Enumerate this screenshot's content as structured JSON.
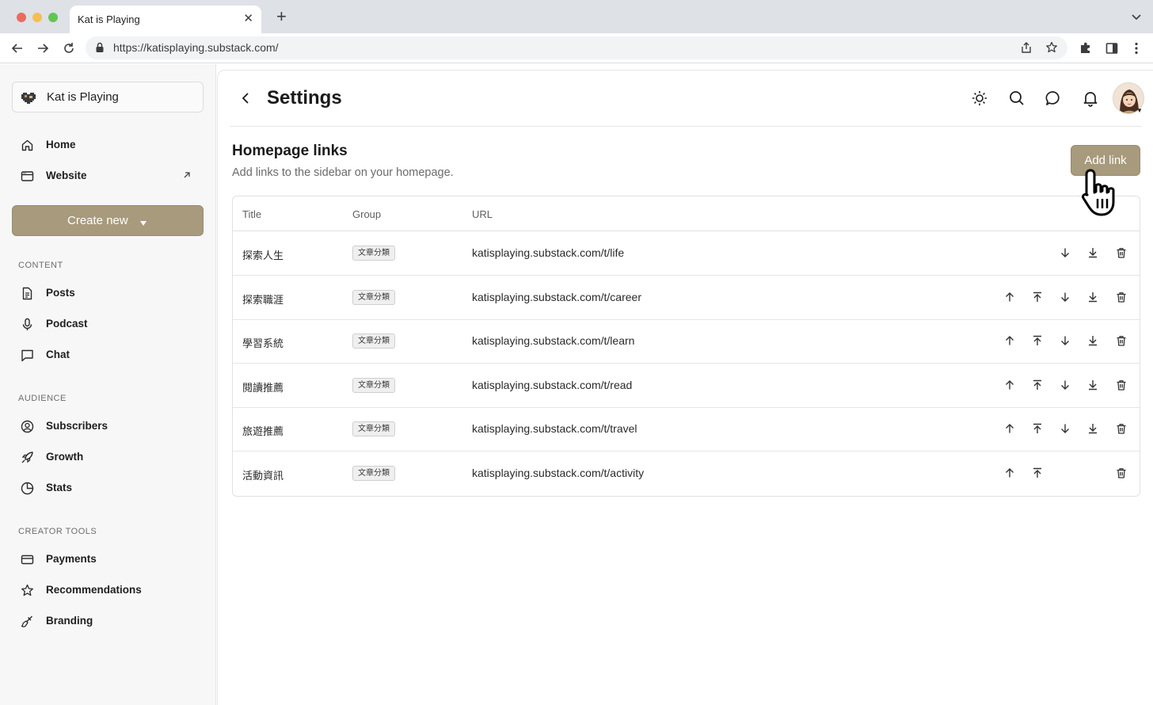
{
  "browser": {
    "tab_title": "Kat is Playing",
    "url": "https://katisplaying.substack.com/"
  },
  "sidebar": {
    "publication": "Kat is Playing",
    "nav": [
      {
        "label": "Home",
        "icon": "home-icon"
      },
      {
        "label": "Website",
        "icon": "browser-window-icon"
      }
    ],
    "create_label": "Create new",
    "sections": [
      {
        "label": "CONTENT",
        "items": [
          {
            "label": "Posts",
            "icon": "document-icon"
          },
          {
            "label": "Podcast",
            "icon": "microphone-icon"
          },
          {
            "label": "Chat",
            "icon": "chat-bubble-icon"
          }
        ]
      },
      {
        "label": "AUDIENCE",
        "items": [
          {
            "label": "Subscribers",
            "icon": "user-circle-icon"
          },
          {
            "label": "Growth",
            "icon": "rocket-icon"
          },
          {
            "label": "Stats",
            "icon": "pie-chart-icon"
          }
        ]
      },
      {
        "label": "CREATOR TOOLS",
        "items": [
          {
            "label": "Payments",
            "icon": "credit-card-icon"
          },
          {
            "label": "Recommendations",
            "icon": "star-icon"
          },
          {
            "label": "Branding",
            "icon": "paintbrush-icon"
          }
        ]
      }
    ]
  },
  "header": {
    "title": "Settings"
  },
  "section": {
    "title": "Homepage links",
    "subtitle": "Add links to the sidebar on your homepage.",
    "add_label": "Add link"
  },
  "table": {
    "columns": [
      "Title",
      "Group",
      "URL"
    ],
    "rows": [
      {
        "title": "探索人生",
        "group": "文章分類",
        "url": "katisplaying.substack.com/t/life",
        "actions": [
          "down",
          "bottom",
          "delete"
        ]
      },
      {
        "title": "探索職涯",
        "group": "文章分類",
        "url": "katisplaying.substack.com/t/career",
        "actions": [
          "up",
          "top",
          "down",
          "bottom",
          "delete"
        ]
      },
      {
        "title": "學習系統",
        "group": "文章分類",
        "url": "katisplaying.substack.com/t/learn",
        "actions": [
          "up",
          "top",
          "down",
          "bottom",
          "delete"
        ]
      },
      {
        "title": "閱讀推薦",
        "group": "文章分類",
        "url": "katisplaying.substack.com/t/read",
        "actions": [
          "up",
          "top",
          "down",
          "bottom",
          "delete"
        ]
      },
      {
        "title": "旅遊推薦",
        "group": "文章分類",
        "url": "katisplaying.substack.com/t/travel",
        "actions": [
          "up",
          "top",
          "down",
          "bottom",
          "delete"
        ]
      },
      {
        "title": "活動資訊",
        "group": "文章分類",
        "url": "katisplaying.substack.com/t/activity",
        "actions": [
          "up",
          "top",
          "delete"
        ]
      }
    ]
  },
  "colors": {
    "accent": "#a89a7c",
    "sidebar_bg": "#f7f7f7"
  }
}
